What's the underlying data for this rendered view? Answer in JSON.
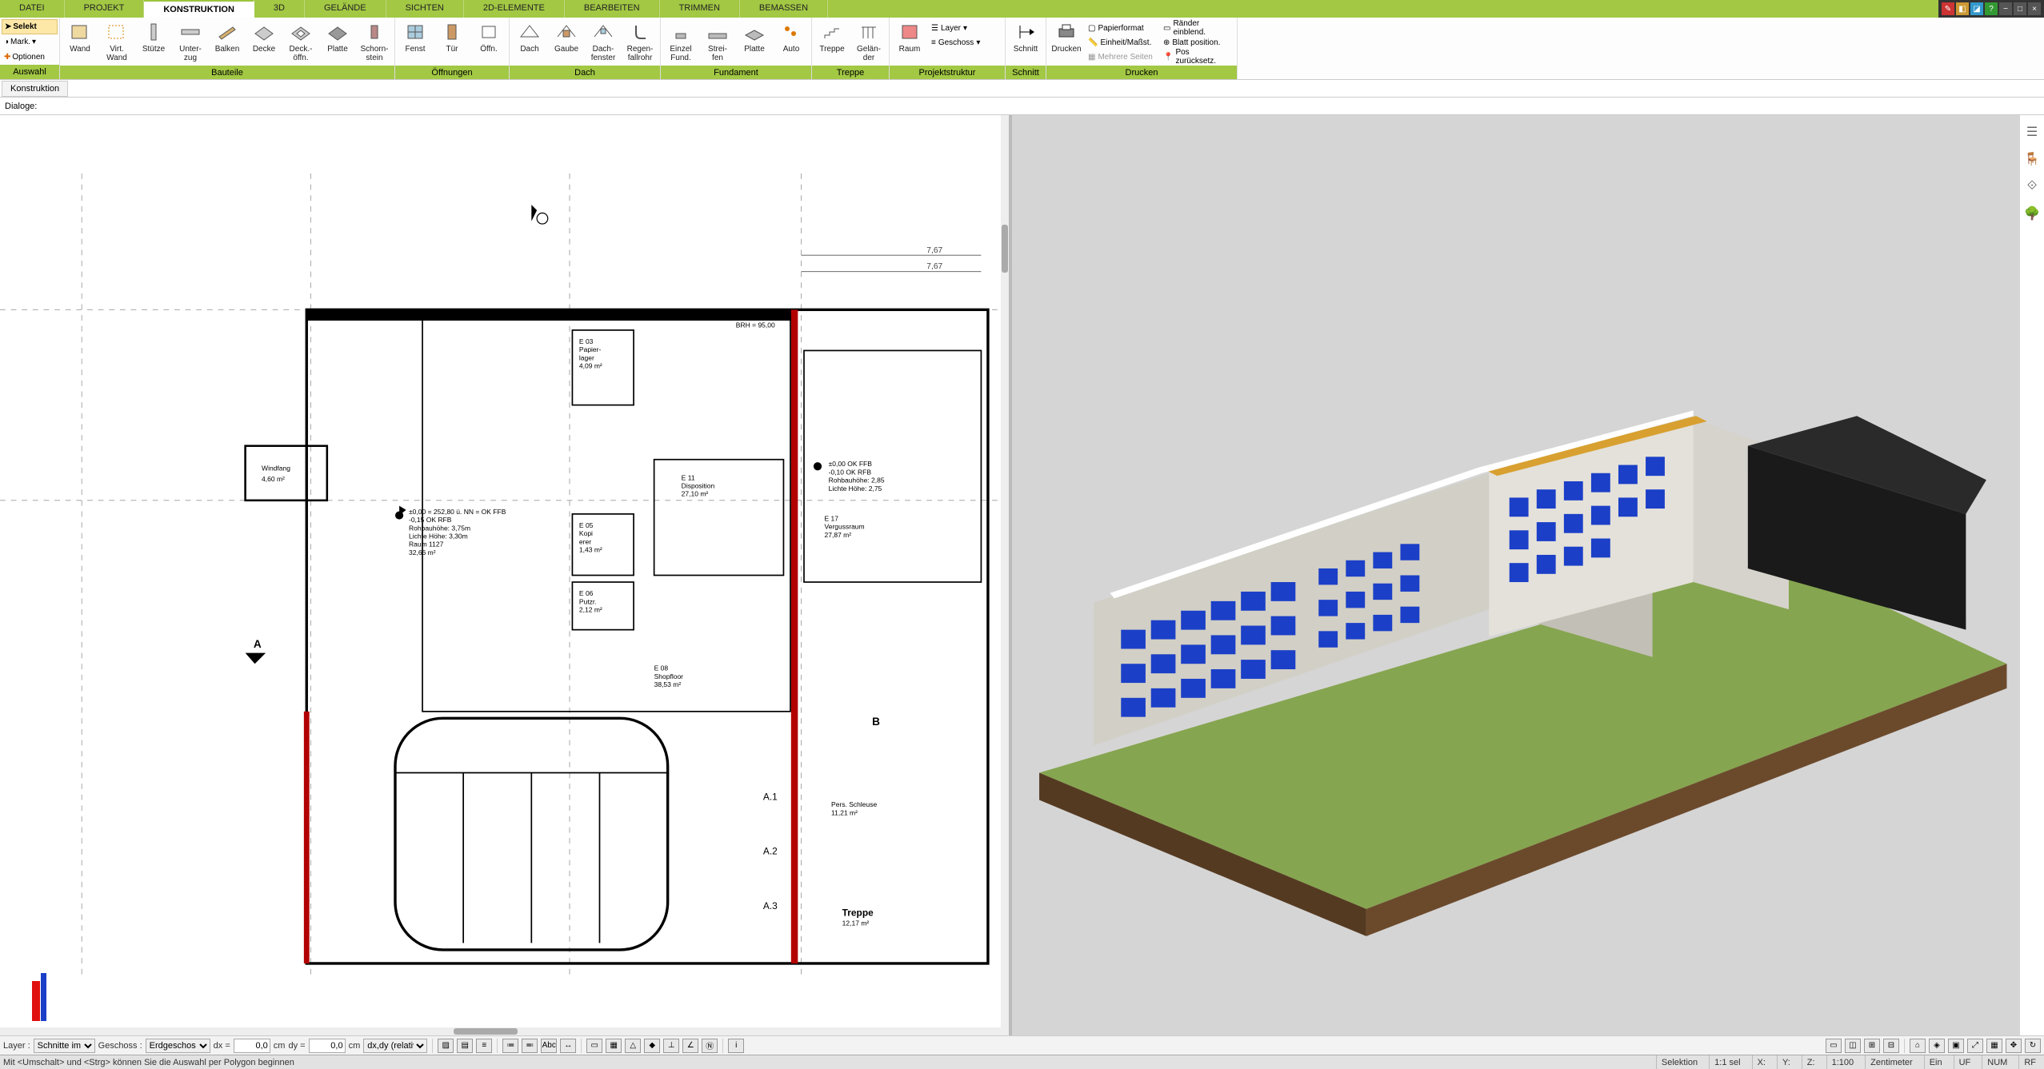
{
  "tabs": [
    "DATEI",
    "PROJEKT",
    "KONSTRUKTION",
    "3D",
    "GELÄNDE",
    "SICHTEN",
    "2D-ELEMENTE",
    "BEARBEITEN",
    "TRIMMEN",
    "BEMASSEN"
  ],
  "active_tab": "KONSTRUKTION",
  "auswahl": {
    "selekt": "Selekt",
    "mark": "Mark.",
    "optionen": "Optionen",
    "label": "Auswahl"
  },
  "group_bauteile": {
    "label": "Bauteile",
    "wand": "Wand",
    "virt_wand": "Virt.\nWand",
    "stuetze": "Stütze",
    "unterzug": "Unter-\nzug",
    "balken": "Balken",
    "decke": "Decke",
    "deckoeffn": "Deck.-\nöffn.",
    "platte": "Platte",
    "schornstein": "Schorn-\nstein"
  },
  "group_oeffnungen": {
    "label": "Öffnungen",
    "fenst": "Fenst",
    "tuer": "Tür",
    "oeffn": "Öffn."
  },
  "group_dach": {
    "label": "Dach",
    "dach": "Dach",
    "gaube": "Gaube",
    "dachfenster": "Dach-\nfenster",
    "regen": "Regen-\nfallrohr"
  },
  "group_fundament": {
    "label": "Fundament",
    "einzel": "Einzel\nFund.",
    "streifen": "Strei-\nfen",
    "platte": "Platte",
    "auto": "Auto"
  },
  "group_treppe": {
    "label": "Treppe",
    "treppe": "Treppe",
    "gelaender": "Gelän-\nder"
  },
  "group_projekt": {
    "label": "Projektstruktur",
    "raum": "Raum",
    "layer": "Layer",
    "geschoss": "Geschoss"
  },
  "group_schnitt": {
    "label": "Schnitt",
    "schnitt": "Schnitt"
  },
  "group_drucken": {
    "label": "Drucken",
    "drucken": "Drucken",
    "papierformat": "Papierformat",
    "einheit": "Einheit/Maßst.",
    "mehrere": "Mehrere Seiten",
    "raender": "Ränder einblend.",
    "blatt": "Blatt position.",
    "pos": "Pos zurücksetz."
  },
  "subtab": "Konstruktion",
  "dialogue_label": "Dialoge:",
  "bottombar": {
    "layer_label": "Layer :",
    "layer_value": "Schnitte im",
    "geschoss_label": "Geschoss :",
    "geschoss_value": "Erdgeschos",
    "dx_label": "dx =",
    "dx_value": "0,0",
    "dx_unit": "cm",
    "dy_label": "dy =",
    "dy_value": "0,0",
    "dy_unit": "cm",
    "rel": "dx,dy (relativ ka"
  },
  "status": {
    "hint": "Mit <Umschalt> und <Strg> können Sie die Auswahl per Polygon beginnen",
    "selektion": "Selektion",
    "sel": "1:1 sel",
    "x": "X:",
    "y": "Y:",
    "z": "Z:",
    "scale": "1:100",
    "unit": "Zentimeter",
    "ein": "Ein",
    "uf": "UF",
    "num": "NUM",
    "rf": "RF"
  },
  "plan": {
    "windfang": "Windfang",
    "windfang_area": "4,60 m²",
    "note1_line1": "±0,00 = 252,80 ü. NN = OK FFB",
    "note1_line2": "-0,15 OK RFB",
    "note1_line3": "Rohbauhöhe: 3,75m",
    "note1_line4": "Lichte Höhe: 3,30m",
    "note1_line5": "Raum 1127",
    "note1_line6": "32,66 m²",
    "note2_line1": "±0,00  OK FFB",
    "note2_line2": "-0,10 OK RFB",
    "note2_line3": "Rohbauhöhe: 2,85",
    "note2_line4": "Lichte Höhe: 2,75",
    "e03": "E 03",
    "e03b": "Papier-",
    "e03c": "lager",
    "e03d": "4,09 m²",
    "e05": "E 05",
    "e05b": "Kopi",
    "e05c": "erer",
    "e05d": "1,43 m²",
    "e06": "E 06",
    "e06b": "Putzr.",
    "e06c": "2,12 m²",
    "e08": "E 08",
    "e08b": "Shopfloor",
    "e08c": "38,53 m²",
    "e11": "E 11",
    "e11b": "Disposition",
    "e11c": "27,10 m²",
    "e17": "E 17",
    "e17b": "Vergussraum",
    "e17c": "27,87 m²",
    "treppe": "Treppe",
    "treppe_area": "12,17 m²",
    "pers_schleuse": "Pers. Schleuse",
    "pers_area": "11,21 m²",
    "markA": "A",
    "markA1": "A.1",
    "markA2": "A.2",
    "markA3": "A.3",
    "markB": "B",
    "brh": "BRH = 95,00",
    "dim1": "7,67",
    "dim2": "7,67"
  }
}
